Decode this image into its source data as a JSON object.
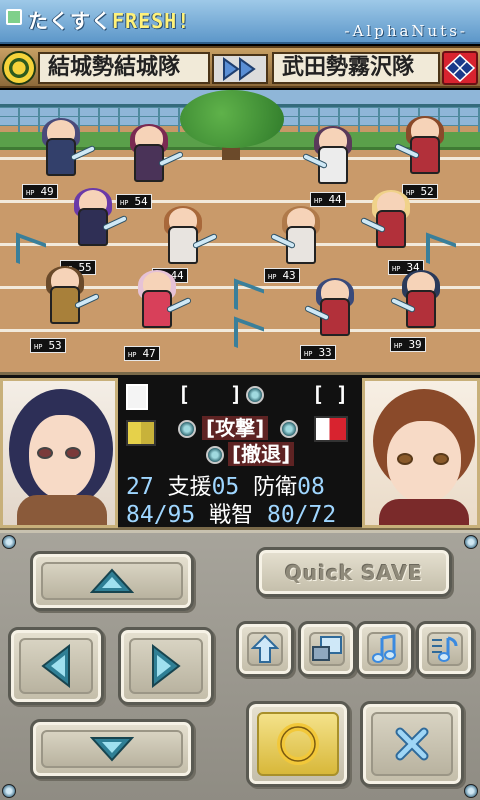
{
  "title_bar": {
    "app_title_main": "たくすく",
    "app_title_fresh": "FRESH!",
    "developer": "-AlphaNuts-",
    "menu_icon": "square-menu-icon"
  },
  "team_header": {
    "left_team": "結城勢結城隊",
    "right_team": "武田勢霧沢隊",
    "left_crest": "green-gold-crest-icon",
    "right_crest": "red-diamond-crest-icon",
    "versus_icon": "double-arrow-right-icon"
  },
  "battlefield": {
    "units": [
      {
        "hp": "49",
        "side": "left",
        "hair": "#4a4a7a",
        "outfit": "#33406b"
      },
      {
        "hp": "54",
        "side": "left",
        "hair": "#7a2a52",
        "outfit": "#4a3358"
      },
      {
        "hp": "55",
        "side": "left",
        "hair": "#6a3aa8",
        "outfit": "#2f2f55"
      },
      {
        "hp": "44",
        "side": "left",
        "hair": "#a8683a",
        "outfit": "#e8e4e0"
      },
      {
        "hp": "53",
        "side": "left",
        "hair": "#6a4a2a",
        "outfit": "#a8803a"
      },
      {
        "hp": "47",
        "side": "left",
        "hair": "#e6c2d6",
        "outfit": "#d8405a"
      },
      {
        "hp": "44",
        "side": "right",
        "hair": "#5a3a5a",
        "outfit": "#ececec"
      },
      {
        "hp": "52",
        "side": "right",
        "hair": "#8a4a2a",
        "outfit": "#b2303a"
      },
      {
        "hp": "43",
        "side": "right",
        "hair": "#b07a4a",
        "outfit": "#e8e4e0"
      },
      {
        "hp": "34",
        "side": "right",
        "hair": "#f0d28a",
        "outfit": "#b2303a"
      },
      {
        "hp": "33",
        "side": "right",
        "hair": "#3a4a7a",
        "outfit": "#b2303a"
      },
      {
        "hp": "39",
        "side": "right",
        "hair": "#2a3a5a",
        "outfit": "#b2303a"
      }
    ],
    "hp_label": "HP"
  },
  "status_panel": {
    "left_portrait": "commander-left-portrait",
    "right_portrait": "commander-right-portrait",
    "commands": {
      "slot_open": "[",
      "slot_close": "]",
      "attack": "[攻撃]",
      "retreat": "[撤退]"
    },
    "stats": {
      "row1": {
        "left_value": "27",
        "support_label": "支援",
        "support_value": "05",
        "defense_label": "防衛",
        "defense_value": "08"
      },
      "row2": {
        "troops": "84/95",
        "tactics_label": "戦智",
        "tactics_value": "80/72"
      }
    }
  },
  "controls": {
    "quick_save_label": "Quick SAVE",
    "dpad": [
      "up-arrow-icon",
      "left-arrow-icon",
      "right-arrow-icon",
      "down-arrow-icon"
    ],
    "small_buttons": [
      "upload-arrow-icon",
      "window-icon",
      "music-note-icon",
      "music-settings-icon"
    ],
    "confirm_icon": "circle-confirm-icon",
    "cancel_icon": "x-cancel-icon",
    "colors": {
      "confirm": "#f2c83a",
      "cancel": "#7ec0ee",
      "arrow": "#3a8aa0"
    }
  }
}
